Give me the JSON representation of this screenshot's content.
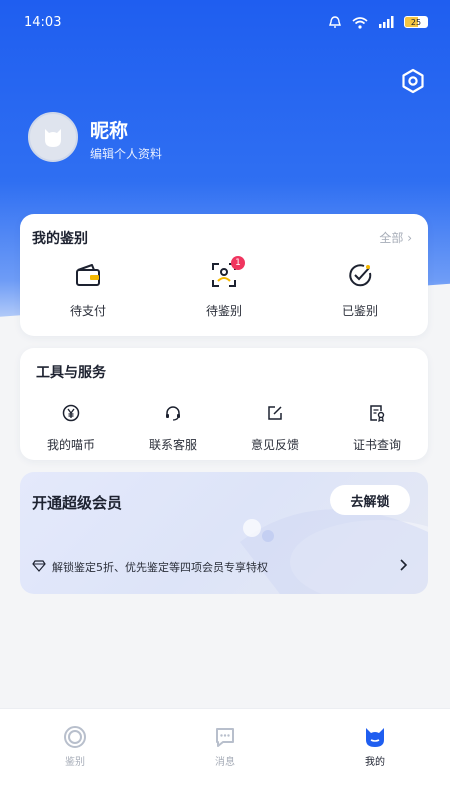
{
  "status_bar": {
    "time": "14:03",
    "battery": "25"
  },
  "profile": {
    "nickname": "昵称",
    "edit_label": "编辑个人资料"
  },
  "my_authentication": {
    "title": "我的鉴别",
    "all_label": "全部 ›",
    "items": [
      {
        "label": "待支付",
        "icon": "wallet-icon"
      },
      {
        "label": "待鉴别",
        "icon": "scan-icon",
        "badge": "1"
      },
      {
        "label": "已鉴别",
        "icon": "check-circle-icon"
      }
    ]
  },
  "tools": {
    "title": "工具与服务",
    "items": [
      {
        "label": "我的喵币",
        "icon": "yen-coin-icon"
      },
      {
        "label": "联系客服",
        "icon": "headset-icon"
      },
      {
        "label": "意见反馈",
        "icon": "edit-icon"
      },
      {
        "label": "证书查询",
        "icon": "certificate-icon"
      }
    ]
  },
  "vip": {
    "title": "开通超级会员",
    "button": "去解锁",
    "desc": "解锁鉴定5折、优先鉴定等四项会员专享特权"
  },
  "tabbar": {
    "items": [
      {
        "label": "鉴别",
        "icon": "authenticate-tab-icon"
      },
      {
        "label": "消息",
        "icon": "message-tab-icon"
      },
      {
        "label": "我的",
        "icon": "profile-tab-icon",
        "active": true
      }
    ]
  },
  "colors": {
    "accent": "#1f5ef0",
    "badge": "#f0355f",
    "text": "#1d2230"
  }
}
